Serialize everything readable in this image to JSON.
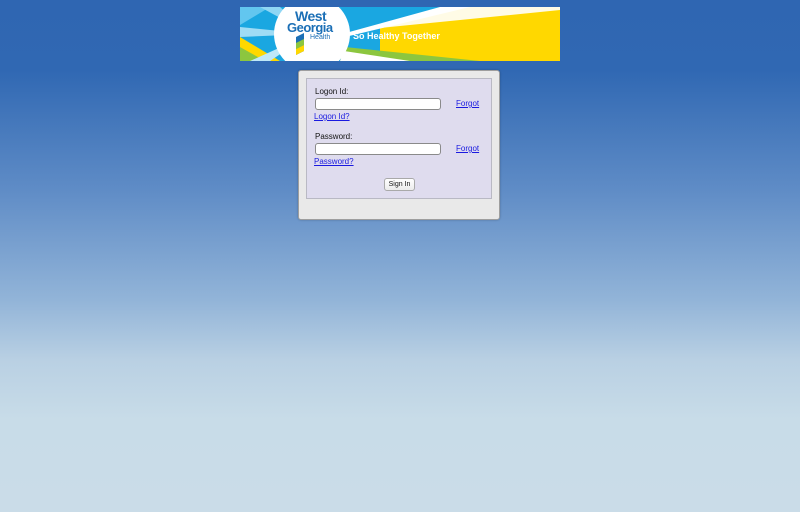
{
  "banner": {
    "logo_line1": "West",
    "logo_line2": "Georgia",
    "logo_line3": "Health",
    "tagline": "So Healthy Together",
    "colors": {
      "yellow": "#ffd800",
      "sky": "#1aa7e1",
      "logo_text": "#1b6fb6",
      "green": "#8cc63f"
    }
  },
  "login": {
    "logon_id_label": "Logon Id:",
    "logon_id_value": "",
    "forgot_logon_word": "Forgot",
    "forgot_logon_rest": "Logon Id?",
    "password_label": "Password:",
    "password_value": "",
    "forgot_password_word": "Forgot",
    "forgot_password_rest": "Password?",
    "sign_in_label": "Sign In"
  }
}
